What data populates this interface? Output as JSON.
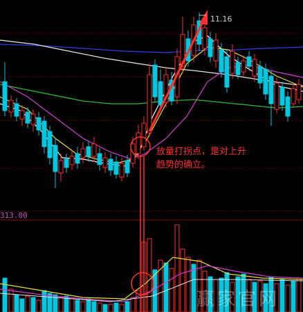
{
  "chart_data": [
    {
      "type": "candlestick",
      "annotations": {
        "peak_price": "11.16",
        "note_line1": "放量打拐点，是对上升",
        "note_line2": "趋势的确立。"
      },
      "colors": {
        "up": "#ff3030",
        "down": "#00c8e0",
        "ma_white": "#e8e8e8",
        "ma_yellow": "#e8e040",
        "ma_magenta": "#d040d0",
        "ma_green": "#30c030",
        "ma_blue": "#3040e0",
        "grid": "#8b0000"
      },
      "grid": true
    },
    {
      "type": "bar",
      "title": "313.00",
      "colors": {
        "up": "#ff3030",
        "down": "#00c8e0",
        "ma_white": "#e8e8e8",
        "ma_yellow": "#e8e040",
        "ma_magenta": "#d040d0"
      }
    }
  ],
  "watermark": "赢家官网"
}
